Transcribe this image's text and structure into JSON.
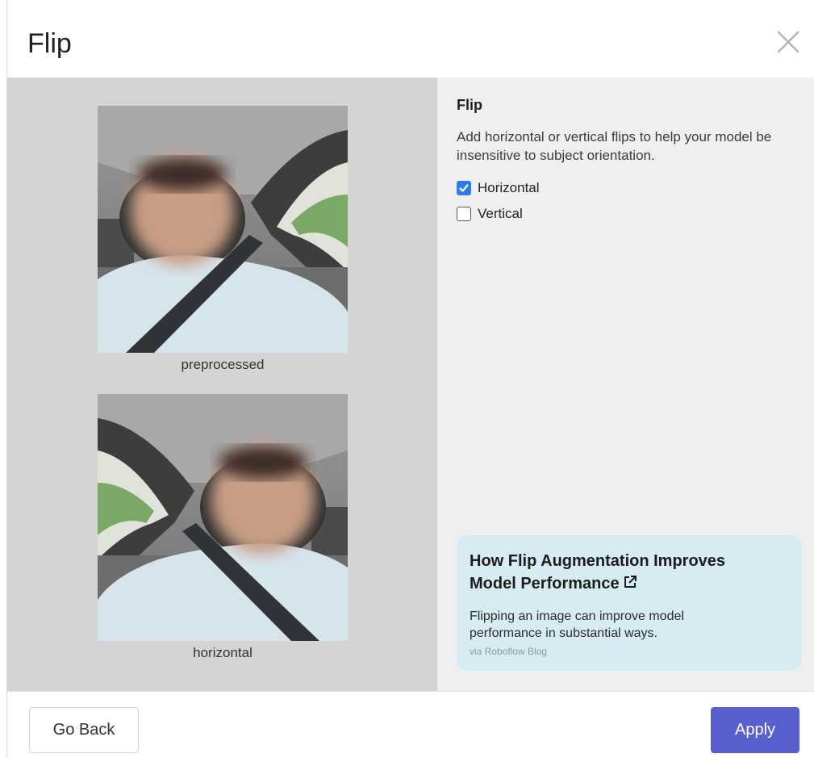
{
  "dialog": {
    "title": "Flip",
    "close_icon": "close-icon"
  },
  "preview": {
    "original_caption": "preprocessed",
    "flipped_caption": "horizontal"
  },
  "settings": {
    "title": "Flip",
    "description": "Add horizontal or vertical flips to help your model be insensitive to subject orientation.",
    "options": [
      {
        "label": "Horizontal",
        "checked": true
      },
      {
        "label": "Vertical",
        "checked": false
      }
    ],
    "accent_color": "#2e7be6"
  },
  "blog_card": {
    "title": "How Flip Augmentation Improves Model Performance",
    "icon": "external-link-icon",
    "text": "Flipping an image can improve model performance in substantial ways.",
    "source": "via Roboflow Blog",
    "background": "#d7ecf2"
  },
  "footer": {
    "back_label": "Go Back",
    "apply_label": "Apply",
    "apply_color": "#5a5fd0"
  }
}
